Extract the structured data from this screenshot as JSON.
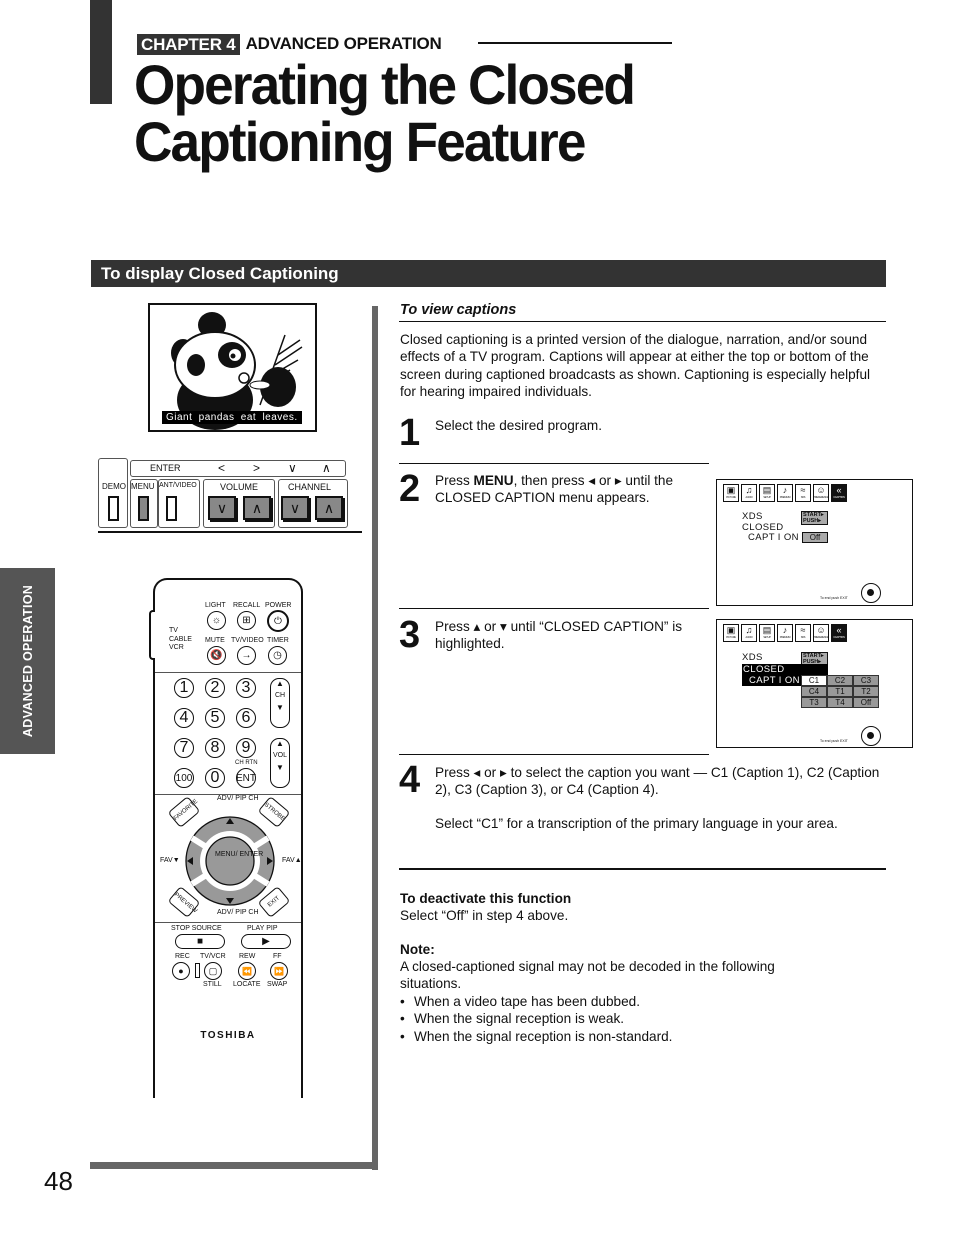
{
  "header": {
    "chapter_badge": "CHAPTER 4",
    "chapter_name": "ADVANCED OPERATION",
    "title_line1": "Operating the Closed",
    "title_line2": "Captioning Feature"
  },
  "section": {
    "title": "To display Closed Captioning"
  },
  "side_tab": {
    "label": "ADVANCED OPERATION"
  },
  "page_number": "48",
  "illustration": {
    "tv_caption": "Giant pandas eat leaves.",
    "front_panel": {
      "enter_label": "ENTER",
      "arrows": [
        "<",
        ">",
        "∨",
        "∧"
      ],
      "buttons": [
        "DEMO",
        "MENU",
        "ANT/VIDEO"
      ],
      "volume_label": "VOLUME",
      "channel_label": "CHANNEL"
    },
    "remote": {
      "mode_labels": [
        "TV",
        "CABLE",
        "VCR"
      ],
      "top_labels": [
        "LIGHT",
        "RECALL",
        "POWER"
      ],
      "mid_labels": [
        "MUTE",
        "TV/VIDEO",
        "TIMER"
      ],
      "digits": [
        "1",
        "2",
        "3",
        "4",
        "5",
        "6",
        "7",
        "8",
        "9",
        "100",
        "0",
        "ENT"
      ],
      "ch_label": "CH",
      "vol_label": "VOL",
      "ch_rtn_label": "CH RTN",
      "adv_pip_ch": "ADV/ PIP CH",
      "favorite": "FAVORITE",
      "strobe": "STROBE",
      "preview": "PREVIEW",
      "exit": "EXIT",
      "fav_down": "FAV▼",
      "fav_up": "FAV▲",
      "menu_enter": "MENU/ ENTER",
      "stop_source": "STOP SOURCE",
      "play_pip": "PLAY PIP",
      "rec": "REC",
      "tv_vcr": "TV/VCR",
      "rew": "REW",
      "ff": "FF",
      "still": "STILL",
      "locate": "LOCATE",
      "swap": "SWAP",
      "brand": "TOSHIBA"
    }
  },
  "content": {
    "view_title": "To view captions",
    "intro": "Closed captioning is a printed version of the dialogue, narration, and/or sound effects of a TV program. Captions will appear at either the top or bottom of the screen during captioned broadcasts as shown. Captioning is especially helpful for hearing impaired individuals.",
    "steps": [
      {
        "num": "1",
        "text": "Select the desired program."
      },
      {
        "num": "2",
        "pre": "Press ",
        "bold": "MENU",
        "post": ", then press ◂ or ▸ until the CLOSED CAPTION menu appears."
      },
      {
        "num": "3",
        "text": "Press ▴ or ▾ until “CLOSED CAPTION” is highlighted."
      },
      {
        "num": "4",
        "text": "Press ◂ or ▸ to select the caption you want — C1 (Caption 1), C2 (Caption 2), C3 (Caption 3), or C4 (Caption 4).",
        "extra": "Select “C1” for a transcription of the primary language in your area."
      }
    ],
    "deactivate_title": "To deactivate this function",
    "deactivate_text": "Select “Off” in step 4 above.",
    "note_title": "Note:",
    "note_text": "A closed-captioned signal may not be decoded in the following situations.",
    "note_items": [
      "When a video tape has been dubbed.",
      "When the signal reception is weak.",
      "When the signal reception is non-standard."
    ]
  },
  "osd": {
    "icons": [
      {
        "glyph": "▣",
        "label": "PICTURE"
      },
      {
        "glyph": "♫",
        "label": "AUDIO"
      },
      {
        "glyph": "▤",
        "label": "SETUP"
      },
      {
        "glyph": "♪",
        "label": "PREMIUM"
      },
      {
        "glyph": "≈",
        "label": "SRS"
      },
      {
        "glyph": "☺",
        "label": "PREFERENCE"
      },
      {
        "glyph": "«",
        "label": "CCAPTION"
      }
    ],
    "xds": "XDS",
    "closed": "CLOSED",
    "caption": "CAPT I ON",
    "start_push": "START▸ PUSH▸",
    "off_value": "Off",
    "options": [
      "C1",
      "C2",
      "C3",
      "C4",
      "T1",
      "T2",
      "T3",
      "T4",
      "Off"
    ],
    "selected_option": "C1",
    "footer": "To end push EXIT"
  }
}
